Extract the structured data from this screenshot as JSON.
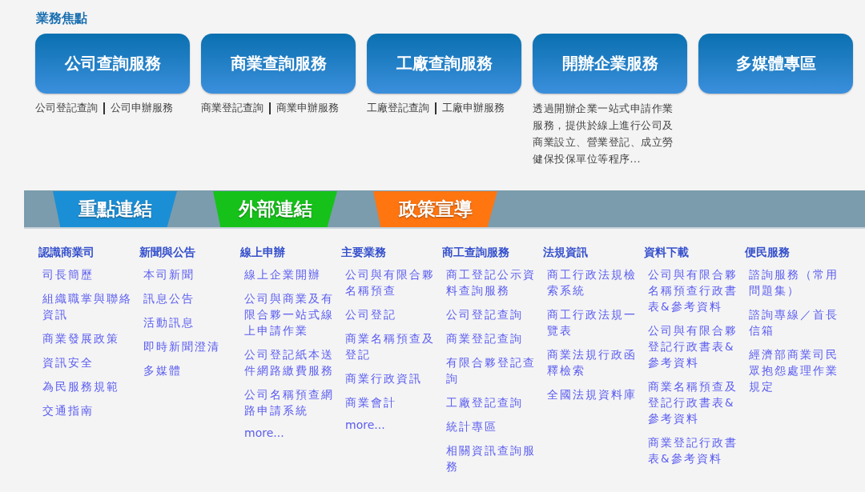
{
  "section_title": "業務焦點",
  "services": [
    {
      "title": "公司查詢服務",
      "links": [
        "公司登記查詢",
        "公司申辦服務"
      ]
    },
    {
      "title": "商業查詢服務",
      "links": [
        "商業登記查詢",
        "商業申辦服務"
      ]
    },
    {
      "title": "工廠查詢服務",
      "links": [
        "工廠登記查詢",
        "工廠申辦服務"
      ]
    },
    {
      "title": "開辦企業服務",
      "description": "透過開辦企業一站式申請作業服務，提供於線上進行公司及商業設立、營業登記、成立勞健保投保單位等程序..."
    },
    {
      "title": "多媒體專區"
    }
  ],
  "link_tabs": [
    {
      "label": "重點連結",
      "color": "#1b8fd6"
    },
    {
      "label": "外部連結",
      "color": "#16c21a"
    },
    {
      "label": "政策宣導",
      "color": "#ff7510"
    }
  ],
  "columns": [
    {
      "heading": "認識商業司",
      "items": [
        "司長簡歷",
        "組織職掌與聯絡資訊",
        "商業發展政策",
        "資訊安全",
        "為民服務規範",
        "交通指南"
      ]
    },
    {
      "heading": "新聞與公告",
      "items": [
        "本司新聞",
        "訊息公告",
        "活動訊息",
        "即時新聞澄清",
        "多媒體"
      ]
    },
    {
      "heading": "線上申辦",
      "items": [
        "線上企業開辦",
        "公司與商業及有限合夥一站式線上申請作業",
        "公司登記紙本送件網路繳費服務",
        "公司名稱預查網路申請系統"
      ],
      "more": "more..."
    },
    {
      "heading": "主要業務",
      "items": [
        "公司與有限合夥名稱預查",
        "公司登記",
        "商業名稱預查及登記",
        "商業行政資訊",
        "商業會計"
      ],
      "more": "more..."
    },
    {
      "heading": "商工查詢服務",
      "items": [
        "商工登記公示資料查詢服務",
        "公司登記查詢",
        "商業登記查詢",
        "有限合夥登記查詢",
        "工廠登記查詢",
        "統計專區",
        "相關資訊查詢服務"
      ]
    },
    {
      "heading": "法規資訊",
      "items": [
        "商工行政法規檢索系統",
        "商工行政法規一覽表",
        "商業法規行政函釋檢索",
        "全國法規資料庫"
      ]
    },
    {
      "heading": "資料下載",
      "items": [
        "公司與有限合夥名稱預查行政書表&參考資料",
        "公司與有限合夥登記行政書表&參考資料",
        "商業名稱預查及登記行政書表&參考資料",
        "商業登記行政書表&參考資料"
      ]
    },
    {
      "heading": "便民服務",
      "items": [
        "諮詢服務（常用問題集）",
        "諮詢專線／首長信箱",
        "經濟部商業司民眾抱怨處理作業規定"
      ]
    }
  ]
}
